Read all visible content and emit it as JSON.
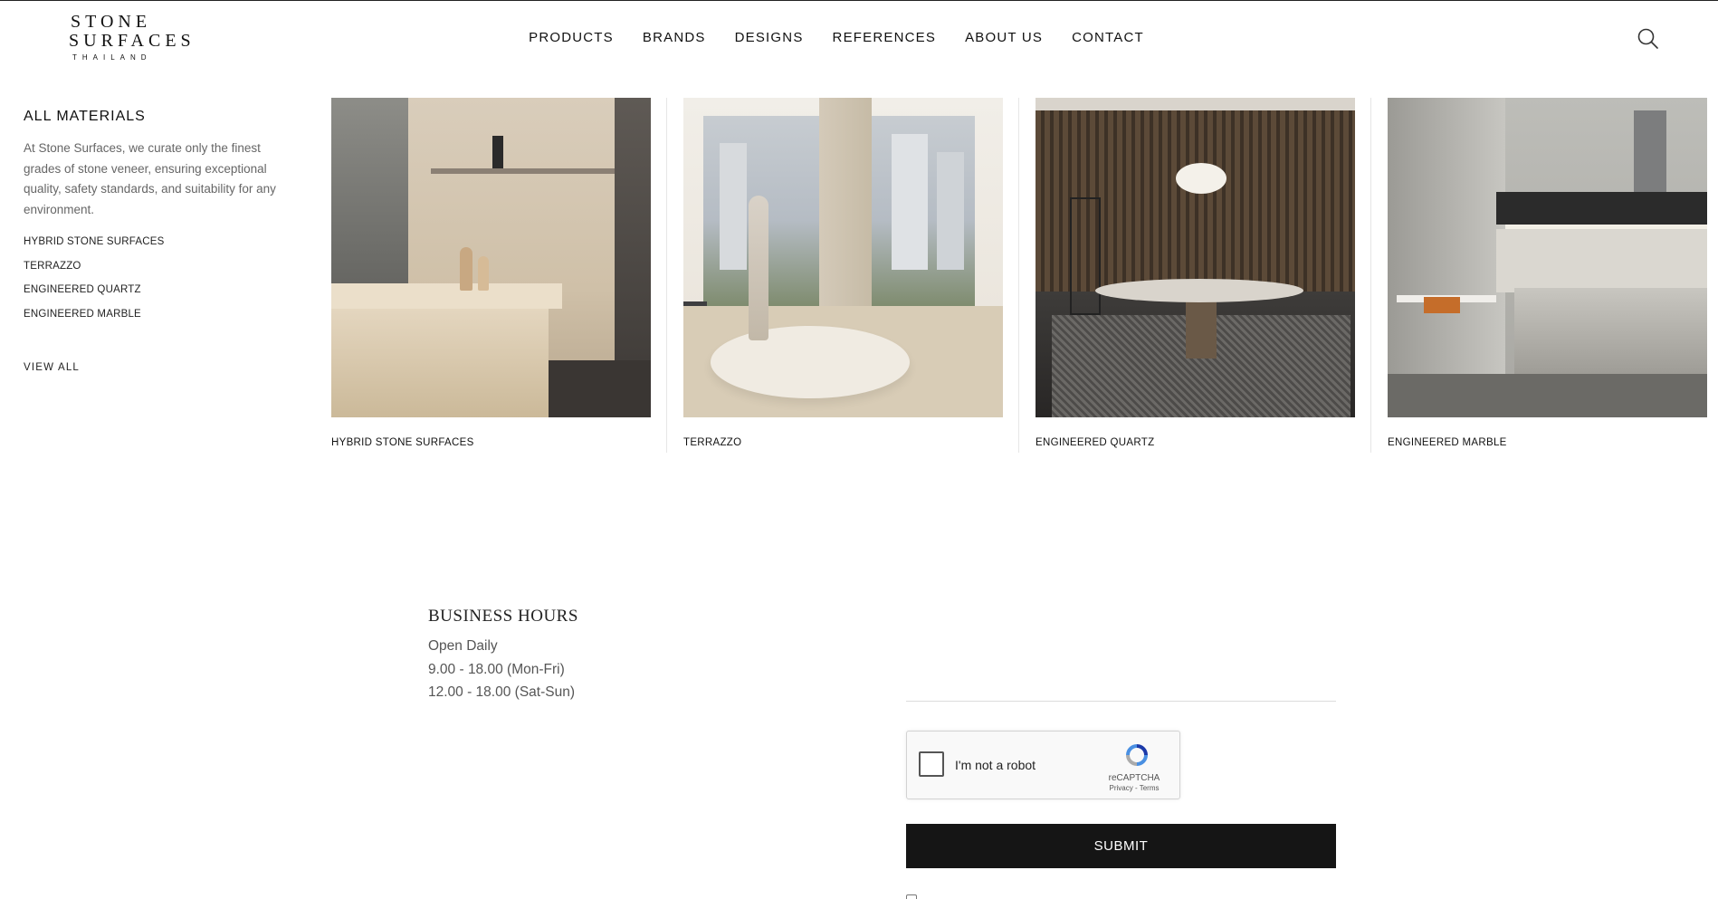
{
  "brand": {
    "line1": "STONE",
    "line2": "SURFACES",
    "line3": "THAILAND"
  },
  "nav": {
    "items": [
      "PRODUCTS",
      "BRANDS",
      "DESIGNS",
      "REFERENCES",
      "ABOUT US",
      "CONTACT"
    ]
  },
  "search": {
    "icon": "search-icon"
  },
  "menu": {
    "title": "ALL MATERIALS",
    "description": "At Stone Surfaces, we curate only the finest grades of stone veneer, ensuring exceptional quality, safety standards, and suitability for any environment.",
    "links": [
      "HYBRID STONE SURFACES",
      "TERRAZZO",
      "ENGINEERED QUARTZ",
      "ENGINEERED MARBLE"
    ],
    "view_all": "VIEW ALL"
  },
  "cards": [
    {
      "label": "HYBRID STONE SURFACES"
    },
    {
      "label": "TERRAZZO"
    },
    {
      "label": "ENGINEERED QUARTZ"
    },
    {
      "label": "ENGINEERED MARBLE"
    }
  ],
  "hours": {
    "title": "BUSINESS HOURS",
    "lines": [
      "Open Daily",
      "9.00 - 18.00 (Mon-Fri)",
      "12.00 - 18.00 (Sat-Sun)"
    ]
  },
  "captcha": {
    "label": "I'm not a robot",
    "brand": "reCAPTCHA",
    "links": "Privacy - Terms"
  },
  "form": {
    "submit_label": "SUBMIT"
  }
}
